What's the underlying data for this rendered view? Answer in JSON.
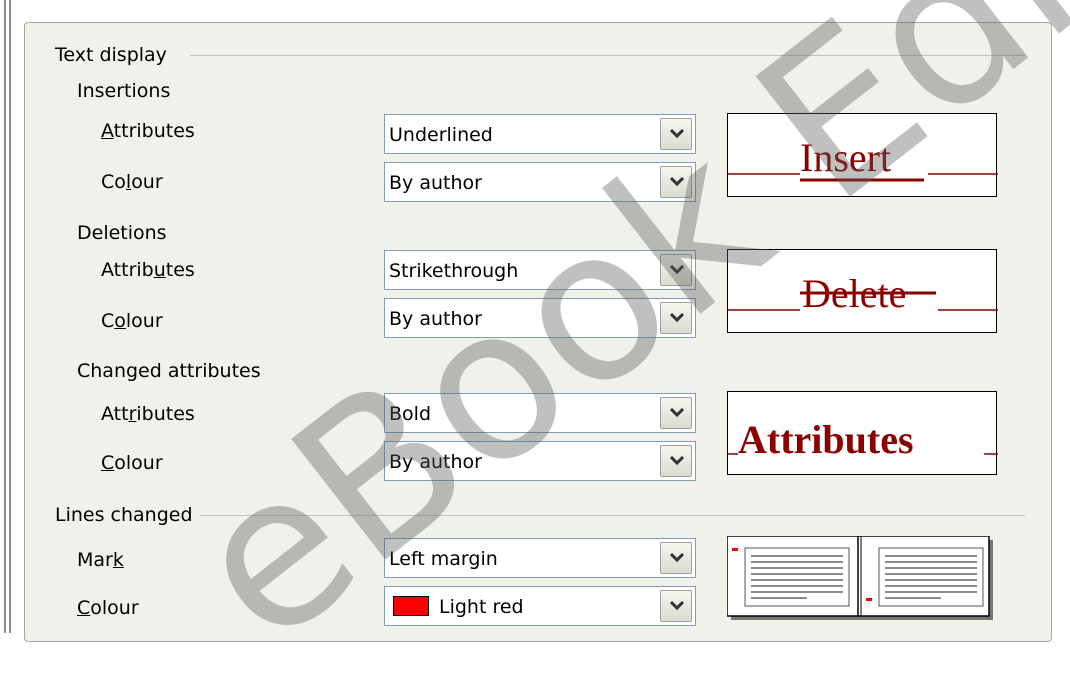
{
  "sections": {
    "text_display": "Text display",
    "insertions": "Insertions",
    "deletions": "Deletions",
    "changed_attributes": "Changed attributes",
    "lines_changed": "Lines changed"
  },
  "insertions": {
    "attributes_label": {
      "pre": "",
      "key": "A",
      "post": "ttributes"
    },
    "attributes_value": "Underlined",
    "colour_label": {
      "pre": "Co",
      "key": "l",
      "post": "our"
    },
    "colour_value": "By author",
    "preview_text": "Insert"
  },
  "deletions": {
    "attributes_label": {
      "pre": "Attrib",
      "key": "u",
      "post": "tes"
    },
    "attributes_value": "Strikethrough",
    "colour_label": {
      "pre": "C",
      "key": "o",
      "post": "lour"
    },
    "colour_value": "By author",
    "preview_text": "Delete"
  },
  "changed": {
    "attributes_label": {
      "pre": "Att",
      "key": "r",
      "post": "ibutes"
    },
    "attributes_value": "Bold",
    "colour_label": {
      "pre": "",
      "key": "C",
      "post": "olour"
    },
    "colour_value": "By author",
    "preview_text": "Attributes"
  },
  "lines": {
    "mark_label": {
      "pre": "Mar",
      "key": "k",
      "post": ""
    },
    "mark_value": "Left margin",
    "colour_label": {
      "pre": "",
      "key": "C",
      "post": "olour"
    },
    "colour_value": "Light red",
    "colour_swatch": "#ff0000"
  },
  "watermark": "eBook Edi",
  "colors": {
    "accent_dark_red": "#8b0000",
    "panel_bg": "#f1f0ea",
    "combo_border": "#7f9db9"
  },
  "icons": [
    "chevron-down-icon",
    "color-swatch-icon",
    "page-thumbnail-icon"
  ]
}
